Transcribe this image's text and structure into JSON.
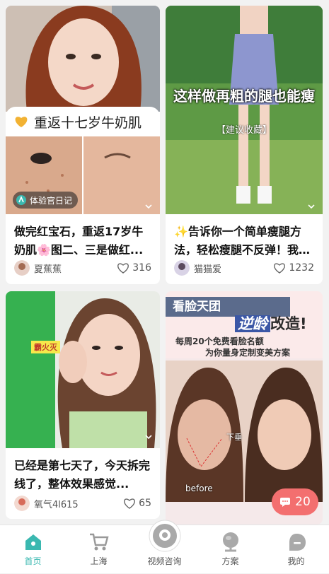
{
  "cards": [
    {
      "overlay_title": "重返十七岁牛奶肌",
      "tag": "体验官日记",
      "title": "做完红宝石，重返17岁牛奶肌🌸图二、三是做红...",
      "author": "夏蕉蕉",
      "likes": "316"
    },
    {
      "overlay_title": "这样做再粗的腿也能瘦",
      "overlay_subtitle": "【建议收藏】",
      "title": "✨告诉你一个简单瘦腿方法，轻松瘦腿不反弹！我的...",
      "author": "猫猫爱",
      "likes": "1232"
    },
    {
      "overlay_sticker": "霸火灭",
      "title": "已经是第七天了，今天拆完线了，整体效果感觉...",
      "author": "氧气4l615",
      "likes": "65"
    },
    {
      "banner_title": "看脸天团",
      "banner_highlight": "逆龄",
      "banner_suffix": "改造!",
      "banner_line1": "每周20个免费看脸名额",
      "banner_line2": "为你量身定制变美方案",
      "photo_label_1": "下垂",
      "photo_label_2": "before"
    }
  ],
  "chat_bubble": {
    "count": "20"
  },
  "nav": [
    {
      "label": "首页",
      "icon": "home-icon",
      "active": true
    },
    {
      "label": "上海",
      "icon": "cart-icon"
    },
    {
      "label": "视频咨询",
      "icon": "video-chat-icon"
    },
    {
      "label": "方案",
      "icon": "plan-icon"
    },
    {
      "label": "我的",
      "icon": "profile-icon"
    }
  ],
  "colors": {
    "accent": "#3ab8b0",
    "bubble": "#f36f6f",
    "gold": "#f2b233"
  }
}
